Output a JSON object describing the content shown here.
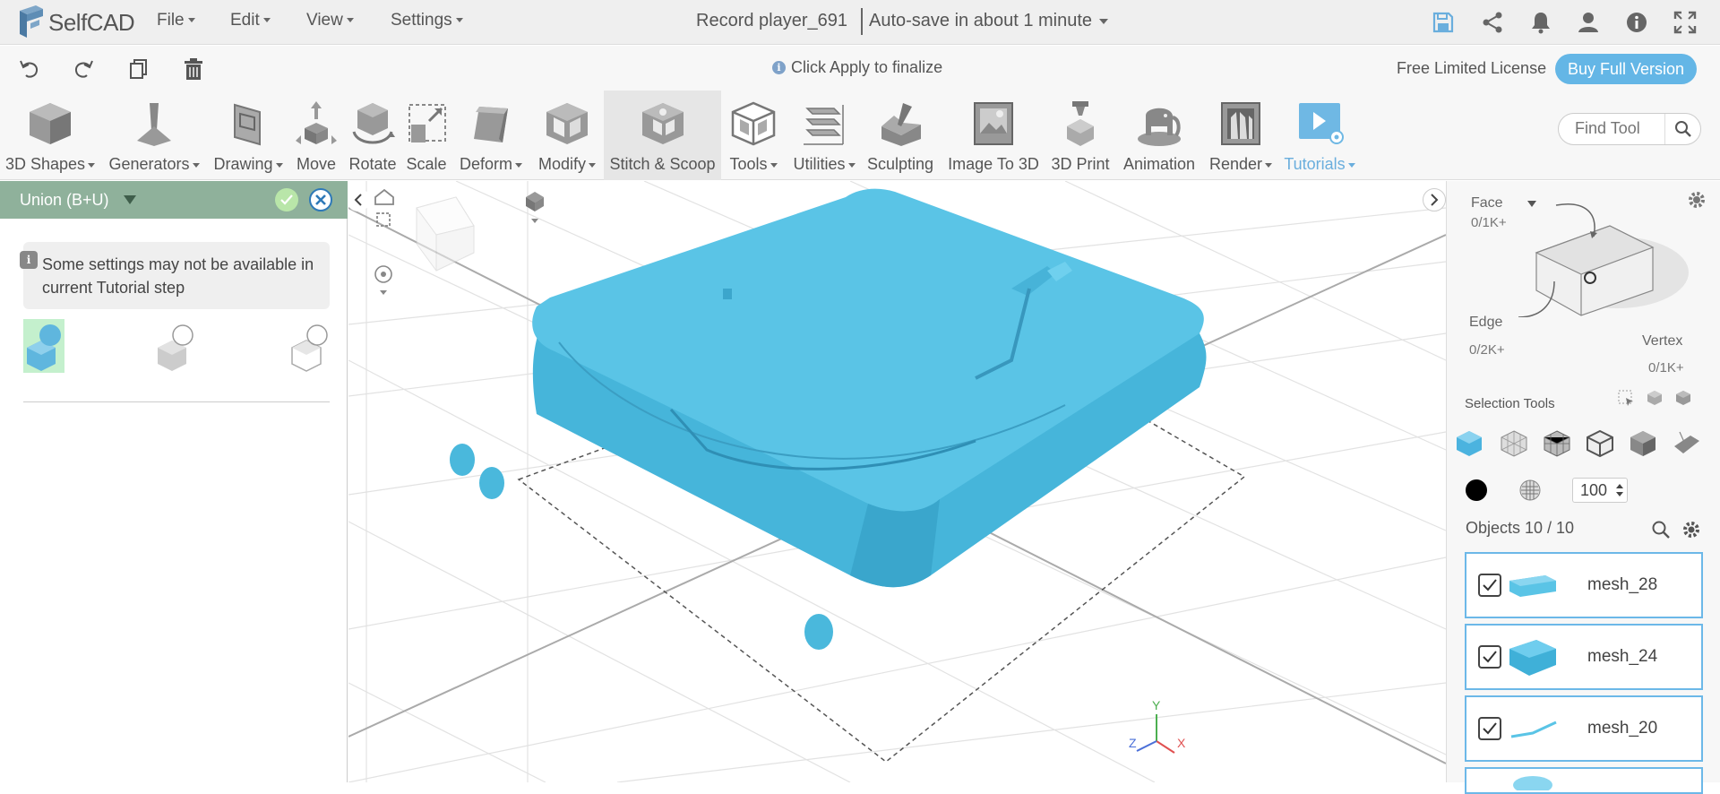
{
  "app": {
    "name": "SelfCAD"
  },
  "menu": {
    "file": "File",
    "edit": "Edit",
    "view": "View",
    "settings": "Settings"
  },
  "document": {
    "title": "Record player_691",
    "autosave": "Auto-save in about 1 minute"
  },
  "bar2": {
    "hint": "Click Apply to finalize",
    "license": "Free Limited License",
    "buy": "Buy Full Version"
  },
  "toolbar": {
    "tools": [
      {
        "label": "3D Shapes"
      },
      {
        "label": "Generators"
      },
      {
        "label": "Drawing"
      },
      {
        "label": "Move"
      },
      {
        "label": "Rotate"
      },
      {
        "label": "Scale"
      },
      {
        "label": "Deform"
      },
      {
        "label": "Modify"
      },
      {
        "label": "Stitch & Scoop"
      },
      {
        "label": "Tools"
      },
      {
        "label": "Utilities"
      },
      {
        "label": "Sculpting"
      },
      {
        "label": "Image To 3D"
      },
      {
        "label": "3D Print"
      },
      {
        "label": "Animation"
      },
      {
        "label": "Render"
      },
      {
        "label": "Tutorials"
      }
    ],
    "find_placeholder": "Find Tool"
  },
  "left_panel": {
    "title": "Union (B+U)",
    "note": "Some settings may not be available in current Tutorial step"
  },
  "viewport": {
    "axes": {
      "y": "Y",
      "x": "X",
      "z": "Z"
    }
  },
  "right_panel": {
    "face_label": "Face",
    "face_count": "0/1K+",
    "edge_label": "Edge",
    "edge_count": "0/2K+",
    "vertex_label": "Vertex",
    "vertex_count": "0/1K+",
    "selection_tools": "Selection Tools",
    "opacity_value": "100",
    "objects_title": "Objects 10 / 10",
    "objects": [
      {
        "name": "mesh_28"
      },
      {
        "name": "mesh_24"
      },
      {
        "name": "mesh_20"
      }
    ]
  },
  "colors": {
    "accent": "#64b6e6",
    "model": "#4fbde0",
    "panel_header": "#8fb19b"
  }
}
